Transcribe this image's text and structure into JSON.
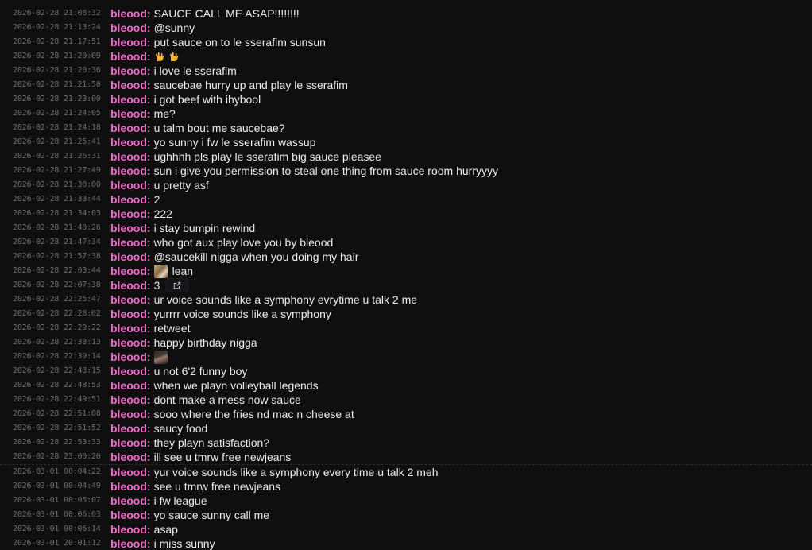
{
  "messages": [
    {
      "ts": "2026-02-28 21:08:32",
      "user": "bleood",
      "text": "SAUCE CALL ME ASAP!!!!!!!!"
    },
    {
      "ts": "2026-02-28 21:13:24",
      "user": "bleood",
      "text": "@sunny"
    },
    {
      "ts": "2026-02-28 21:17:51",
      "user": "bleood",
      "text": "put sauce on to le sserafim sunsun"
    },
    {
      "ts": "2026-02-28 21:20:09",
      "user": "bleood",
      "text": "",
      "emojis": [
        "horns-hand-emoji",
        "horns-hand-emoji"
      ]
    },
    {
      "ts": "2026-02-28 21:20:36",
      "user": "bleood",
      "text": "i love le sserafim"
    },
    {
      "ts": "2026-02-28 21:21:50",
      "user": "bleood",
      "text": "saucebae hurry up and play le sserafim"
    },
    {
      "ts": "2026-02-28 21:23:00",
      "user": "bleood",
      "text": "i got beef with ihybool"
    },
    {
      "ts": "2026-02-28 21:24:05",
      "user": "bleood",
      "text": "me?"
    },
    {
      "ts": "2026-02-28 21:24:18",
      "user": "bleood",
      "text": "u talm bout me saucebae?"
    },
    {
      "ts": "2026-02-28 21:25:41",
      "user": "bleood",
      "text": "yo sunny i fw le sserafim wassup"
    },
    {
      "ts": "2026-02-28 21:26:31",
      "user": "bleood",
      "text": "ughhhh pls play le sserafim big sauce pleasee"
    },
    {
      "ts": "2026-02-28 21:27:49",
      "user": "bleood",
      "text": "sun i give you permission to steal one thing from sauce room hurryyyy"
    },
    {
      "ts": "2026-02-28 21:30:00",
      "user": "bleood",
      "text": "u pretty asf"
    },
    {
      "ts": "2026-02-28 21:33:44",
      "user": "bleood",
      "text": "2"
    },
    {
      "ts": "2026-02-28 21:34:03",
      "user": "bleood",
      "text": "222"
    },
    {
      "ts": "2026-02-28 21:40:26",
      "user": "bleood",
      "text": "i stay bumpin rewind"
    },
    {
      "ts": "2026-02-28 21:47:34",
      "user": "bleood",
      "text": "who got aux play love you by bleood"
    },
    {
      "ts": "2026-02-28 21:57:38",
      "user": "bleood",
      "text": "@saucekill nigga when you doing my hair"
    },
    {
      "ts": "2026-02-28 22:03:44",
      "user": "bleood",
      "text": "lean",
      "image": "thumb1"
    },
    {
      "ts": "2026-02-28 22:07:38",
      "user": "bleood",
      "text": "3",
      "link": true
    },
    {
      "ts": "2026-02-28 22:25:47",
      "user": "bleood",
      "text": "ur voice sounds like a symphony evrytime u talk 2 me"
    },
    {
      "ts": "2026-02-28 22:28:02",
      "user": "bleood",
      "text": "yurrrr voice sounds like a symphony"
    },
    {
      "ts": "2026-02-28 22:29:22",
      "user": "bleood",
      "text": "retweet"
    },
    {
      "ts": "2026-02-28 22:38:13",
      "user": "bleood",
      "text": "happy birthday nigga"
    },
    {
      "ts": "2026-02-28 22:39:14",
      "user": "bleood",
      "text": "",
      "image": "thumb2"
    },
    {
      "ts": "2026-02-28 22:43:15",
      "user": "bleood",
      "text": "u not 6'2 funny boy"
    },
    {
      "ts": "2026-02-28 22:48:53",
      "user": "bleood",
      "text": "when we playn volleyball legends"
    },
    {
      "ts": "2026-02-28 22:49:51",
      "user": "bleood",
      "text": "dont make a mess now sauce"
    },
    {
      "ts": "2026-02-28 22:51:08",
      "user": "bleood",
      "text": "sooo where the fries nd mac n cheese at"
    },
    {
      "ts": "2026-02-28 22:51:52",
      "user": "bleood",
      "text": "saucy food"
    },
    {
      "ts": "2026-02-28 22:53:33",
      "user": "bleood",
      "text": "they playn satisfaction?"
    },
    {
      "ts": "2026-02-28 23:00:20",
      "user": "bleood",
      "text": "ill see u tmrw free newjeans"
    },
    {
      "ts": "2026-03-01 00:04:22",
      "user": "bleood",
      "text": "yur voice sounds like a symphony every time u talk 2 meh"
    },
    {
      "ts": "2026-03-01 00:04:49",
      "user": "bleood",
      "text": "see u tmrw free newjeans"
    },
    {
      "ts": "2026-03-01 00:05:07",
      "user": "bleood",
      "text": "i fw league"
    },
    {
      "ts": "2026-03-01 00:06:03",
      "user": "bleood",
      "text": "yo sauce sunny call me"
    },
    {
      "ts": "2026-03-01 00:06:14",
      "user": "bleood",
      "text": "asap"
    },
    {
      "ts": "2026-03-01 20:01:12",
      "user": "bleood",
      "text": "i miss sunny"
    }
  ],
  "colors": {
    "background": "#0f0f10",
    "username": "#f06bc7",
    "timestamp": "#6f6f73",
    "message": "#ececec"
  }
}
